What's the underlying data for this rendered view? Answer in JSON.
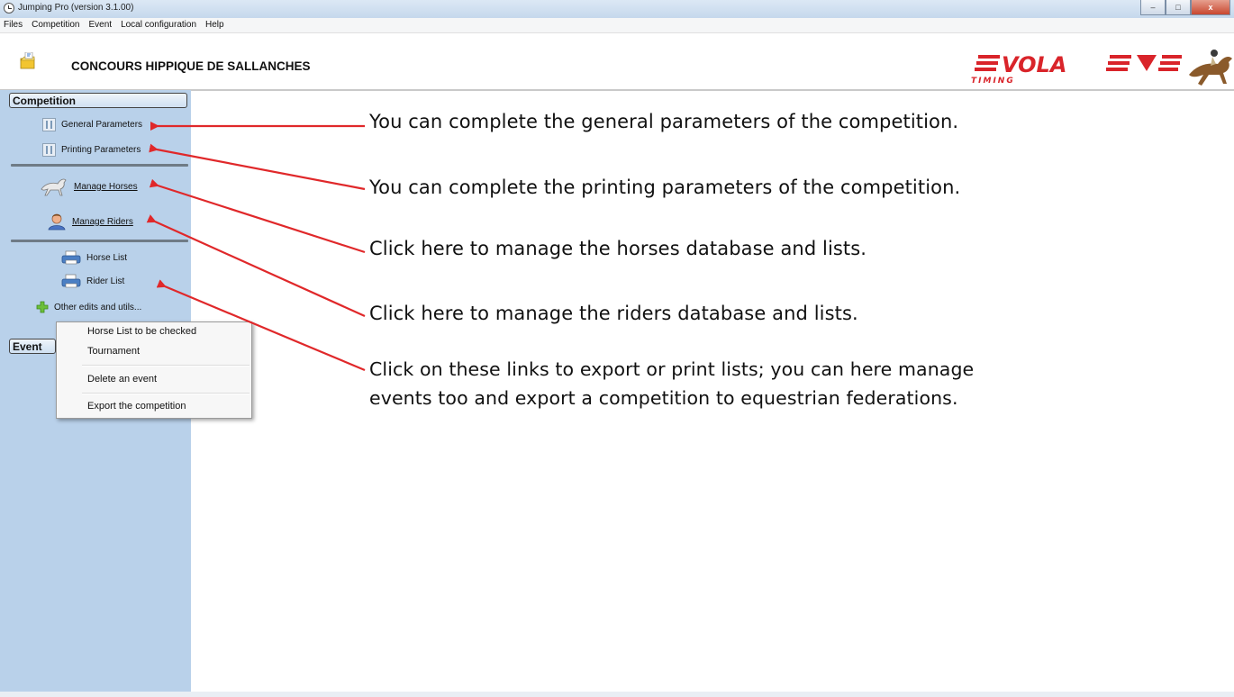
{
  "window": {
    "title": "Jumping Pro (version 3.1.00)",
    "buttons": [
      "–",
      "□",
      "x"
    ]
  },
  "menu": [
    "Files",
    "Competition",
    "Event",
    "Local configuration",
    "Help"
  ],
  "header": {
    "competition_title": "CONCOURS HIPPIQUE DE SALLANCHES",
    "logo_text": "VOLA",
    "logo_subtext": "TIMING"
  },
  "sidebar": {
    "competition_header": "Competition",
    "general_parameters": "General Parameters",
    "printing_parameters": "Printing Parameters",
    "manage_horses": "Manage Horses",
    "manage_riders": "Manage Riders",
    "horse_list": "Horse List",
    "rider_list": "Rider List",
    "other_edits": "Other edits and utils...",
    "event_header": "Event"
  },
  "context_menu": {
    "items": [
      "Horse List to be checked",
      "Tournament",
      "Delete an event",
      "Export the competition"
    ]
  },
  "annotations": {
    "general": "You can complete the general parameters of the competition.",
    "printing": "You can complete the printing parameters of the competition.",
    "horses": "Click here to manage the horses database and lists.",
    "riders": "Click here to manage the riders database and lists.",
    "lists_line1": "Click on these links to export or print lists; you can here manage",
    "lists_line2": "events too and export a competition to equestrian federations."
  },
  "colors": {
    "sidebar": "#b9d1ea",
    "arrow": "#e0282a",
    "logo_red": "#d9242a"
  }
}
